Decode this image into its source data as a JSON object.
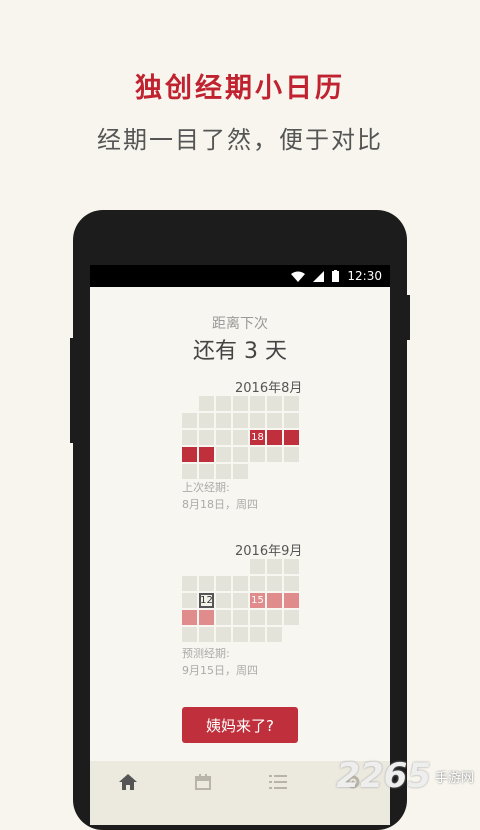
{
  "promo": {
    "title": "独创经期小日历",
    "subtitle": "经期一目了然，便于对比"
  },
  "status_bar": {
    "time": "12:30"
  },
  "countdown": {
    "label": "距离下次",
    "text": "还有 3 天"
  },
  "calendars": [
    {
      "month": "2016年8月",
      "marked_day_label": "18",
      "note_title": "上次经期:",
      "note_value": "8月18日，周四"
    },
    {
      "month": "2016年9月",
      "today_label": "12",
      "marked_day_label": "15",
      "note_title": "预测经期:",
      "note_value": "9月15日，周四"
    }
  ],
  "action_button": "姨妈来了?",
  "nav": [
    {
      "icon": "home-icon",
      "active": true
    },
    {
      "icon": "calendar-icon",
      "active": false
    },
    {
      "icon": "list-icon",
      "active": false
    },
    {
      "icon": "settings-icon",
      "active": false
    }
  ],
  "watermark": {
    "number": "2265",
    "text": "手游网"
  },
  "colors": {
    "accent": "#c0303c",
    "predict": "#e08c8c",
    "background": "#f8f5ee"
  }
}
